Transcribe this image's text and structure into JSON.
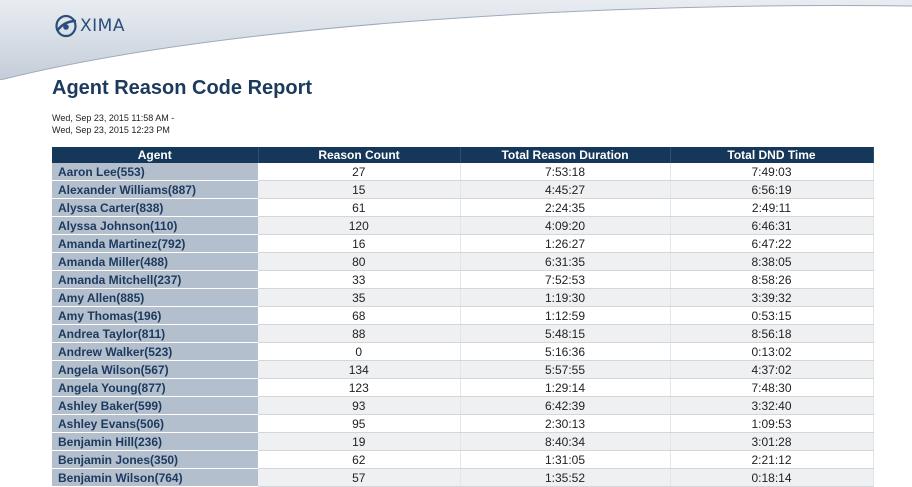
{
  "brand": {
    "logo_text": "XIMA"
  },
  "report": {
    "title": "Agent Reason Code Report",
    "range_start": "Wed, Sep 23, 2015 11:58 AM -",
    "range_end": "Wed, Sep 23, 2015 12:23 PM"
  },
  "table": {
    "headers": [
      "Agent",
      "Reason Count",
      "Total Reason Duration",
      "Total DND Time"
    ],
    "rows": [
      [
        "Aaron Lee(553)",
        "27",
        "7:53:18",
        "7:49:03"
      ],
      [
        "Alexander Williams(887)",
        "15",
        "4:45:27",
        "6:56:19"
      ],
      [
        "Alyssa Carter(838)",
        "61",
        "2:24:35",
        "2:49:11"
      ],
      [
        "Alyssa Johnson(110)",
        "120",
        "4:09:20",
        "6:46:31"
      ],
      [
        "Amanda Martinez(792)",
        "16",
        "1:26:27",
        "6:47:22"
      ],
      [
        "Amanda Miller(488)",
        "80",
        "6:31:35",
        "8:38:05"
      ],
      [
        "Amanda Mitchell(237)",
        "33",
        "7:52:53",
        "8:58:26"
      ],
      [
        "Amy Allen(885)",
        "35",
        "1:19:30",
        "3:39:32"
      ],
      [
        "Amy Thomas(196)",
        "68",
        "1:12:59",
        "0:53:15"
      ],
      [
        "Andrea Taylor(811)",
        "88",
        "5:48:15",
        "8:56:18"
      ],
      [
        "Andrew Walker(523)",
        "0",
        "5:16:36",
        "0:13:02"
      ],
      [
        "Angela Wilson(567)",
        "134",
        "5:57:55",
        "4:37:02"
      ],
      [
        "Angela Young(877)",
        "123",
        "1:29:14",
        "7:48:30"
      ],
      [
        "Ashley Baker(599)",
        "93",
        "6:42:39",
        "3:32:40"
      ],
      [
        "Ashley Evans(506)",
        "95",
        "2:30:13",
        "1:09:53"
      ],
      [
        "Benjamin Hill(236)",
        "19",
        "8:40:34",
        "3:01:28"
      ],
      [
        "Benjamin Jones(350)",
        "62",
        "1:31:05",
        "2:21:12"
      ],
      [
        "Benjamin Wilson(764)",
        "57",
        "1:35:52",
        "0:18:14"
      ]
    ]
  },
  "colors": {
    "header_bg": "#15375a",
    "agent_bg": "#b3bfcd",
    "title": "#1c3a5e"
  }
}
